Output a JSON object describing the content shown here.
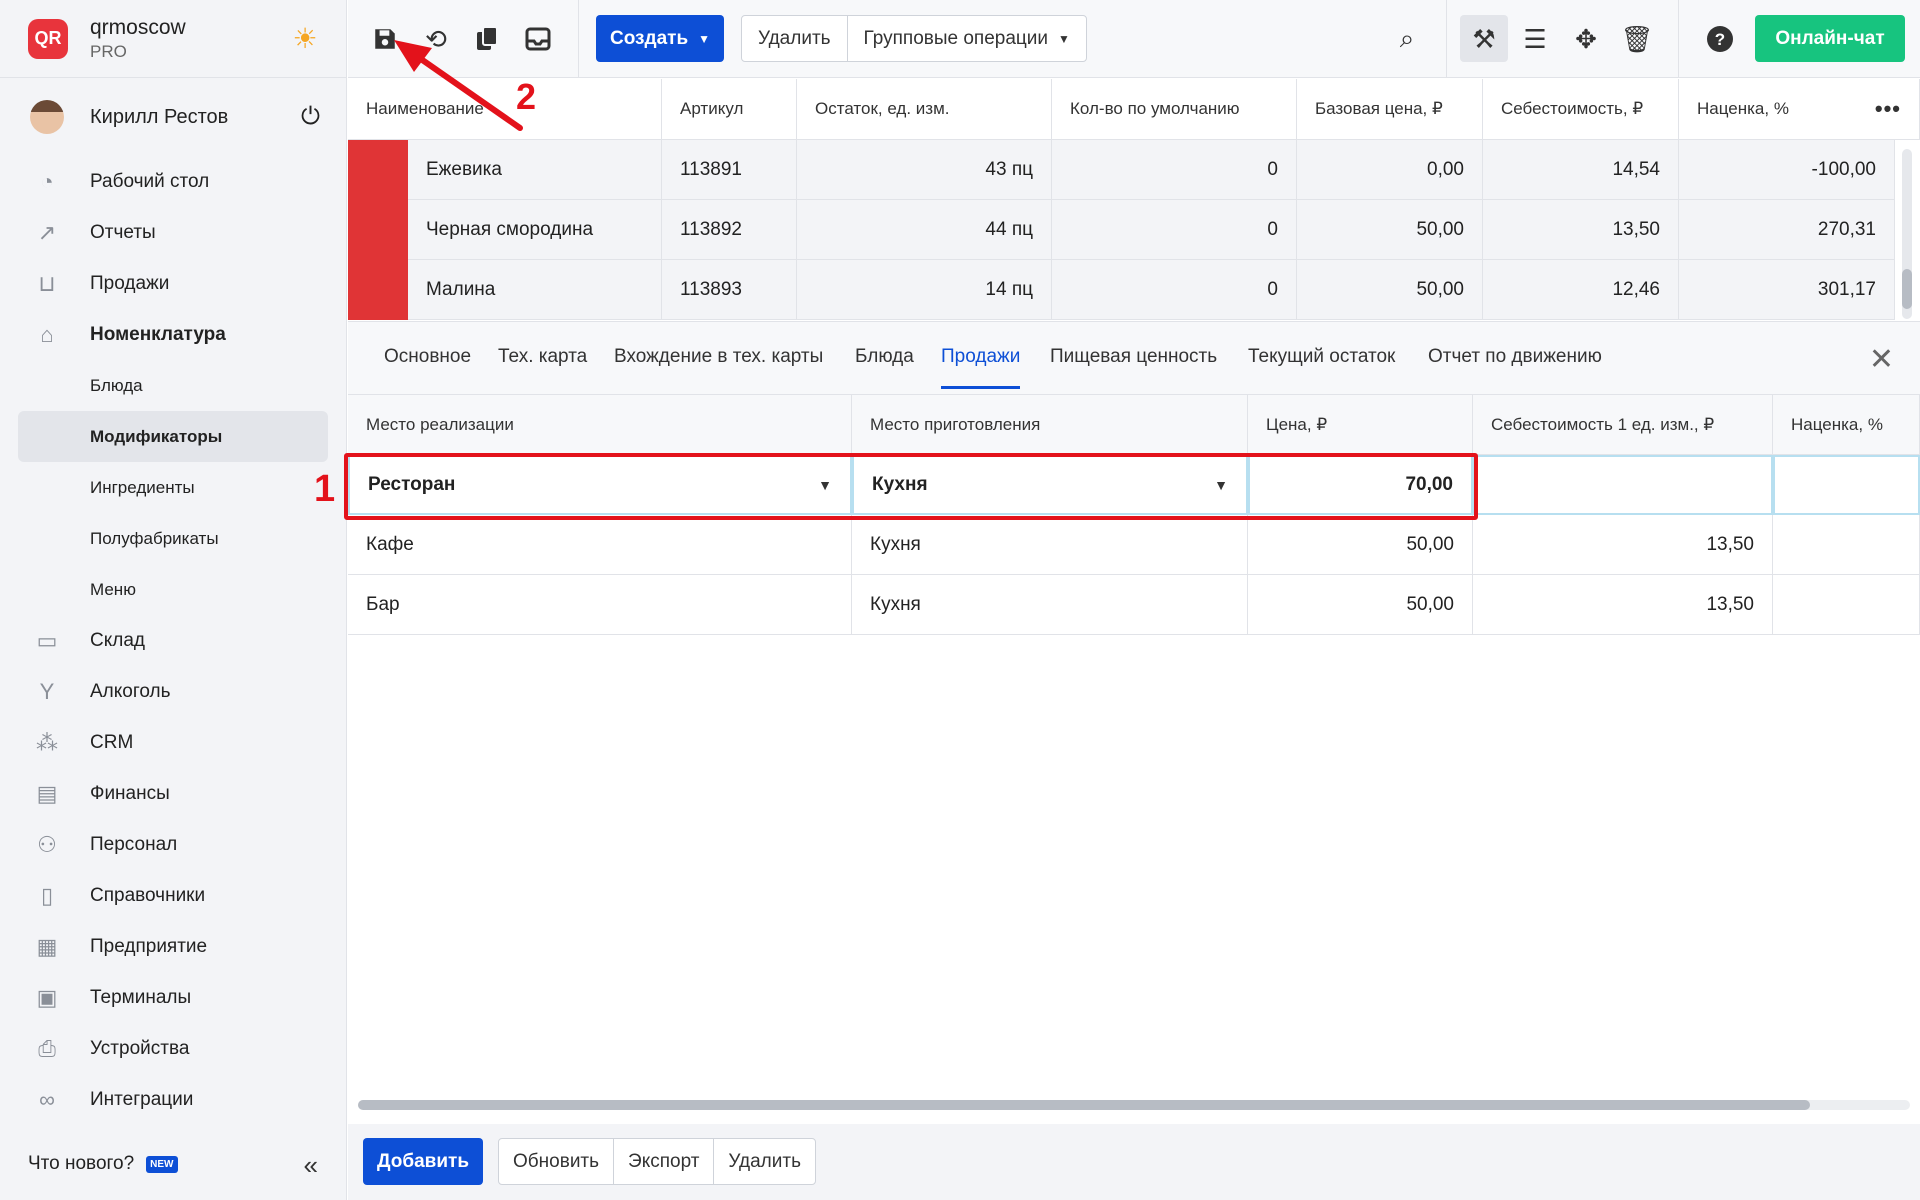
{
  "org": {
    "logo": "QR",
    "name": "qrmoscow",
    "plan": "PRO"
  },
  "user": {
    "name": "Кирилл Рестов"
  },
  "nav": [
    {
      "label": "Рабочий стол",
      "icon": "dashboard-icon"
    },
    {
      "label": "Отчеты",
      "icon": "chart-icon"
    },
    {
      "label": "Продажи",
      "icon": "basket-icon"
    },
    {
      "label": "Номенклатура",
      "icon": "tag-icon"
    }
  ],
  "nav_sub": [
    "Блюда",
    "Модификаторы",
    "Ингредиенты",
    "Полуфабрикаты",
    "Меню"
  ],
  "nav2": [
    {
      "label": "Склад",
      "icon": "box-icon"
    },
    {
      "label": "Алкоголь",
      "icon": "glass-icon"
    },
    {
      "label": "CRM",
      "icon": "crm-icon"
    },
    {
      "label": "Финансы",
      "icon": "wallet-icon"
    },
    {
      "label": "Персонал",
      "icon": "people-icon"
    },
    {
      "label": "Справочники",
      "icon": "book-icon"
    },
    {
      "label": "Предприятие",
      "icon": "store-icon"
    },
    {
      "label": "Терминалы",
      "icon": "terminal-icon"
    },
    {
      "label": "Устройства",
      "icon": "printer-icon"
    },
    {
      "label": "Интеграции",
      "icon": "infinity-icon"
    }
  ],
  "footer": {
    "news": "Что нового?",
    "badge": "NEW"
  },
  "toolbar": {
    "create": "Создать",
    "delete": "Удалить",
    "group_ops": "Групповые операции",
    "chat": "Онлайн-чат"
  },
  "top_table": {
    "headers": [
      "Наименование",
      "Артикул",
      "Остаток, ед. изм.",
      "Кол-во по умолчанию",
      "Базовая цена, ₽",
      "Себестоимость, ₽",
      "Наценка, %"
    ],
    "rows": [
      [
        "Ежевика",
        "113891",
        "43 пц",
        "0",
        "0,00",
        "14,54",
        "-100,00"
      ],
      [
        "Черная смородина",
        "113892",
        "44 пц",
        "0",
        "50,00",
        "13,50",
        "270,31"
      ],
      [
        "Малина",
        "113893",
        "14 пц",
        "0",
        "50,00",
        "12,46",
        "301,17"
      ]
    ]
  },
  "tabs": [
    "Основное",
    "Тех. карта",
    "Вхождение в тех. карты",
    "Блюда",
    "Продажи",
    "Пищевая ценность",
    "Текущий остаток",
    "Отчет по движению"
  ],
  "active_tab": "Продажи",
  "sales_table": {
    "headers": [
      "Место реализации",
      "Место приготовления",
      "Цена, ₽",
      "Себестоимость 1 ед. изм., ₽",
      "Наценка, %"
    ],
    "edit_row": [
      "Ресторан",
      "Кухня",
      "70,00",
      "",
      ""
    ],
    "rows": [
      [
        "Кафе",
        "Кухня",
        "50,00",
        "13,50",
        ""
      ],
      [
        "Бар",
        "Кухня",
        "50,00",
        "13,50",
        ""
      ]
    ]
  },
  "annotations": {
    "one": "1",
    "two": "2"
  },
  "bottom": {
    "add": "Добавить",
    "refresh": "Обновить",
    "export": "Экспорт",
    "delete": "Удалить"
  },
  "colors": {
    "accent": "#0d4fd6",
    "chat": "#17c47f",
    "annotation": "#e3121b",
    "swatch": "#e03436"
  }
}
